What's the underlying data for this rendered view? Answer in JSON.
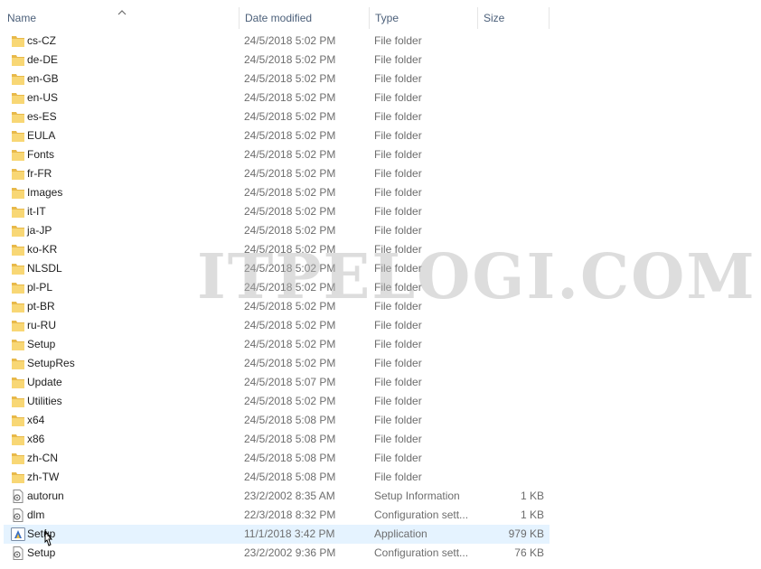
{
  "columns": {
    "name": "Name",
    "date": "Date modified",
    "type": "Type",
    "size": "Size",
    "sorted_by": "name",
    "sort_direction": "ascending"
  },
  "files": [
    {
      "name": "cs-CZ",
      "date": "24/5/2018 5:02 PM",
      "type": "File folder",
      "size": "",
      "icon": "folder-icon"
    },
    {
      "name": "de-DE",
      "date": "24/5/2018 5:02 PM",
      "type": "File folder",
      "size": "",
      "icon": "folder-icon"
    },
    {
      "name": "en-GB",
      "date": "24/5/2018 5:02 PM",
      "type": "File folder",
      "size": "",
      "icon": "folder-icon"
    },
    {
      "name": "en-US",
      "date": "24/5/2018 5:02 PM",
      "type": "File folder",
      "size": "",
      "icon": "folder-icon"
    },
    {
      "name": "es-ES",
      "date": "24/5/2018 5:02 PM",
      "type": "File folder",
      "size": "",
      "icon": "folder-icon"
    },
    {
      "name": "EULA",
      "date": "24/5/2018 5:02 PM",
      "type": "File folder",
      "size": "",
      "icon": "folder-icon"
    },
    {
      "name": "Fonts",
      "date": "24/5/2018 5:02 PM",
      "type": "File folder",
      "size": "",
      "icon": "folder-icon"
    },
    {
      "name": "fr-FR",
      "date": "24/5/2018 5:02 PM",
      "type": "File folder",
      "size": "",
      "icon": "folder-icon"
    },
    {
      "name": "Images",
      "date": "24/5/2018 5:02 PM",
      "type": "File folder",
      "size": "",
      "icon": "folder-icon"
    },
    {
      "name": "it-IT",
      "date": "24/5/2018 5:02 PM",
      "type": "File folder",
      "size": "",
      "icon": "folder-icon"
    },
    {
      "name": "ja-JP",
      "date": "24/5/2018 5:02 PM",
      "type": "File folder",
      "size": "",
      "icon": "folder-icon"
    },
    {
      "name": "ko-KR",
      "date": "24/5/2018 5:02 PM",
      "type": "File folder",
      "size": "",
      "icon": "folder-icon"
    },
    {
      "name": "NLSDL",
      "date": "24/5/2018 5:02 PM",
      "type": "File folder",
      "size": "",
      "icon": "folder-icon"
    },
    {
      "name": "pl-PL",
      "date": "24/5/2018 5:02 PM",
      "type": "File folder",
      "size": "",
      "icon": "folder-icon"
    },
    {
      "name": "pt-BR",
      "date": "24/5/2018 5:02 PM",
      "type": "File folder",
      "size": "",
      "icon": "folder-icon"
    },
    {
      "name": "ru-RU",
      "date": "24/5/2018 5:02 PM",
      "type": "File folder",
      "size": "",
      "icon": "folder-icon"
    },
    {
      "name": "Setup",
      "date": "24/5/2018 5:02 PM",
      "type": "File folder",
      "size": "",
      "icon": "folder-icon"
    },
    {
      "name": "SetupRes",
      "date": "24/5/2018 5:02 PM",
      "type": "File folder",
      "size": "",
      "icon": "folder-icon"
    },
    {
      "name": "Update",
      "date": "24/5/2018 5:07 PM",
      "type": "File folder",
      "size": "",
      "icon": "folder-icon"
    },
    {
      "name": "Utilities",
      "date": "24/5/2018 5:02 PM",
      "type": "File folder",
      "size": "",
      "icon": "folder-icon"
    },
    {
      "name": "x64",
      "date": "24/5/2018 5:08 PM",
      "type": "File folder",
      "size": "",
      "icon": "folder-icon"
    },
    {
      "name": "x86",
      "date": "24/5/2018 5:08 PM",
      "type": "File folder",
      "size": "",
      "icon": "folder-icon"
    },
    {
      "name": "zh-CN",
      "date": "24/5/2018 5:08 PM",
      "type": "File folder",
      "size": "",
      "icon": "folder-icon"
    },
    {
      "name": "zh-TW",
      "date": "24/5/2018 5:08 PM",
      "type": "File folder",
      "size": "",
      "icon": "folder-icon"
    },
    {
      "name": "autorun",
      "date": "23/2/2002 8:35 AM",
      "type": "Setup Information",
      "size": "1 KB",
      "icon": "settings-file-icon"
    },
    {
      "name": "dlm",
      "date": "22/3/2018 8:32 PM",
      "type": "Configuration sett...",
      "size": "1 KB",
      "icon": "settings-file-icon"
    },
    {
      "name": "Setup",
      "date": "11/1/2018 3:42 PM",
      "type": "Application",
      "size": "979 KB",
      "icon": "application-icon",
      "selected": true
    },
    {
      "name": "Setup",
      "date": "23/2/2002 9:36 PM",
      "type": "Configuration sett...",
      "size": "76 KB",
      "icon": "settings-file-icon"
    }
  ],
  "watermark": "ITPELOGI.COM",
  "colors": {
    "folder": "#f8d775",
    "folder_dark": "#e8b94a",
    "selection": "#e5f3ff",
    "header_text": "#4c607a",
    "secondary_text": "#6d6d6d"
  }
}
